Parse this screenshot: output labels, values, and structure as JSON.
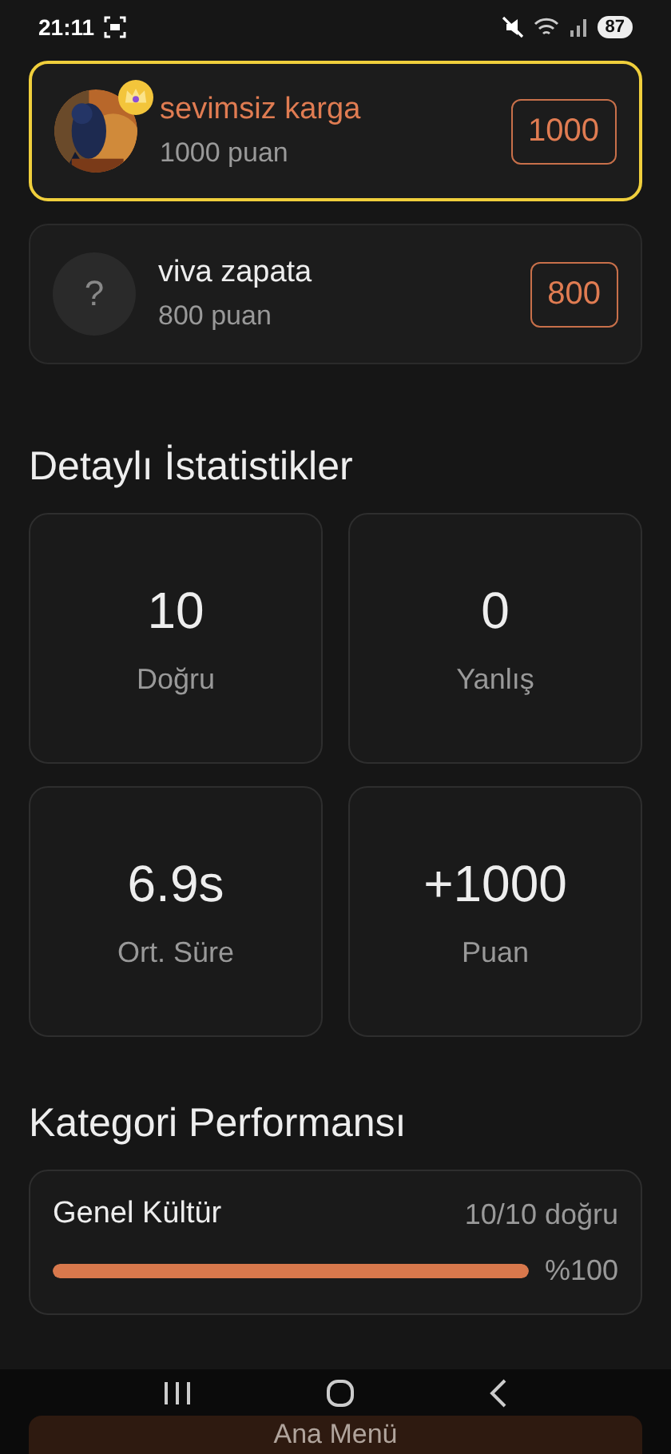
{
  "status_bar": {
    "time": "21:11",
    "battery": "87"
  },
  "players": [
    {
      "name": "sevimsiz karga",
      "points": "1000 puan",
      "score": "1000",
      "selected": true
    },
    {
      "name": "viva zapata",
      "points": "800 puan",
      "score": "800",
      "selected": false,
      "avatar": {
        "kind": "placeholder",
        "text": "?"
      }
    }
  ],
  "stats_title": "Detaylı İstatistikler",
  "stats": [
    {
      "value": "10",
      "label": "Doğru"
    },
    {
      "value": "0",
      "label": "Yanlış"
    },
    {
      "value": "6.9s",
      "label": "Ort. Süre"
    },
    {
      "value": "+1000",
      "label": "Puan"
    }
  ],
  "categories_title": "Kategori Performansı",
  "categories": [
    {
      "name": "Genel Kültür",
      "result": "10/10 doğru",
      "level": 1,
      "percent": "%100"
    }
  ],
  "main_button": "Ana Menü"
}
